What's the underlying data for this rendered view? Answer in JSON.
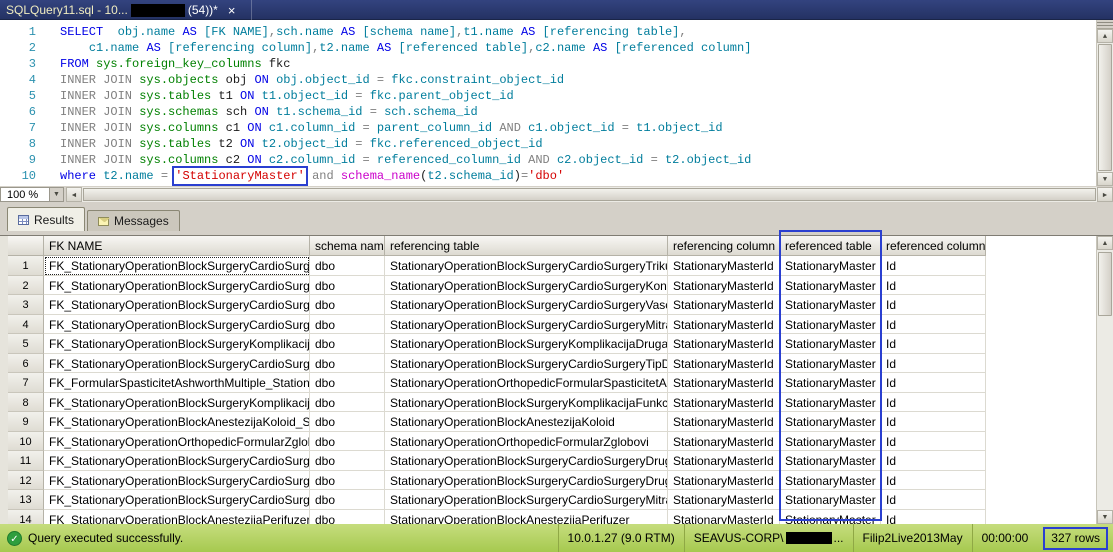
{
  "colors": {
    "annotation_blue": "#2A3FD0",
    "status_bar_green": "#B3D465",
    "keyword_blue": "#0000E6",
    "operator_gray": "#808080",
    "identifier_teal": "#007D9C",
    "system_table_green": "#008000",
    "string_red": "#D40000",
    "function_magenta": "#CA00CA",
    "tab_strip_navy": "#2A3A75"
  },
  "title_tab": {
    "label": "SQLQuery11.sql - 10...",
    "suffix": "(54))*",
    "close": "×"
  },
  "editor": {
    "zoom": "100 %",
    "lines": [
      {
        "n": 1,
        "tokens": [
          [
            "kw",
            "SELECT"
          ],
          [
            "pl",
            "  "
          ],
          [
            "id",
            "obj.name"
          ],
          [
            "pl",
            " "
          ],
          [
            "kw",
            "AS"
          ],
          [
            "pl",
            " "
          ],
          [
            "id",
            "[FK NAME]"
          ],
          [
            "op",
            ","
          ],
          [
            "id",
            "sch.name"
          ],
          [
            "pl",
            " "
          ],
          [
            "kw",
            "AS"
          ],
          [
            "pl",
            " "
          ],
          [
            "id",
            "[schema name]"
          ],
          [
            "op",
            ","
          ],
          [
            "id",
            "t1.name"
          ],
          [
            "pl",
            " "
          ],
          [
            "kw",
            "AS"
          ],
          [
            "pl",
            " "
          ],
          [
            "id",
            "[referencing table]"
          ],
          [
            "op",
            ","
          ]
        ]
      },
      {
        "n": 2,
        "tokens": [
          [
            "pl",
            "    "
          ],
          [
            "id",
            "c1.name"
          ],
          [
            "pl",
            " "
          ],
          [
            "kw",
            "AS"
          ],
          [
            "pl",
            " "
          ],
          [
            "id",
            "[referencing column]"
          ],
          [
            "op",
            ","
          ],
          [
            "id",
            "t2.name"
          ],
          [
            "pl",
            " "
          ],
          [
            "kw",
            "AS"
          ],
          [
            "pl",
            " "
          ],
          [
            "id",
            "[referenced table]"
          ],
          [
            "op",
            ","
          ],
          [
            "id",
            "c2.name"
          ],
          [
            "pl",
            " "
          ],
          [
            "kw",
            "AS"
          ],
          [
            "pl",
            " "
          ],
          [
            "id",
            "[referenced column]"
          ]
        ]
      },
      {
        "n": 3,
        "tokens": [
          [
            "kw",
            "FROM"
          ],
          [
            "pl",
            " "
          ],
          [
            "sys",
            "sys.foreign_key_columns"
          ],
          [
            "pl",
            " fkc"
          ]
        ]
      },
      {
        "n": 4,
        "tokens": [
          [
            "op",
            "INNER JOIN"
          ],
          [
            "pl",
            " "
          ],
          [
            "sys",
            "sys.objects"
          ],
          [
            "pl",
            " obj "
          ],
          [
            "kw",
            "ON"
          ],
          [
            "pl",
            " "
          ],
          [
            "id",
            "obj.object_id"
          ],
          [
            "pl",
            " "
          ],
          [
            "op",
            "="
          ],
          [
            "pl",
            " "
          ],
          [
            "id",
            "fkc.constraint_object_id"
          ]
        ]
      },
      {
        "n": 5,
        "tokens": [
          [
            "op",
            "INNER JOIN"
          ],
          [
            "pl",
            " "
          ],
          [
            "sys",
            "sys.tables"
          ],
          [
            "pl",
            " t1 "
          ],
          [
            "kw",
            "ON"
          ],
          [
            "pl",
            " "
          ],
          [
            "id",
            "t1.object_id"
          ],
          [
            "pl",
            " "
          ],
          [
            "op",
            "="
          ],
          [
            "pl",
            " "
          ],
          [
            "id",
            "fkc.parent_object_id"
          ]
        ]
      },
      {
        "n": 6,
        "tokens": [
          [
            "op",
            "INNER JOIN"
          ],
          [
            "pl",
            " "
          ],
          [
            "sys",
            "sys.schemas"
          ],
          [
            "pl",
            " sch "
          ],
          [
            "kw",
            "ON"
          ],
          [
            "pl",
            " "
          ],
          [
            "id",
            "t1.schema_id"
          ],
          [
            "pl",
            " "
          ],
          [
            "op",
            "="
          ],
          [
            "pl",
            " "
          ],
          [
            "id",
            "sch.schema_id"
          ]
        ]
      },
      {
        "n": 7,
        "tokens": [
          [
            "op",
            "INNER JOIN"
          ],
          [
            "pl",
            " "
          ],
          [
            "sys",
            "sys.columns"
          ],
          [
            "pl",
            " c1 "
          ],
          [
            "kw",
            "ON"
          ],
          [
            "pl",
            " "
          ],
          [
            "id",
            "c1.column_id"
          ],
          [
            "pl",
            " "
          ],
          [
            "op",
            "="
          ],
          [
            "pl",
            " "
          ],
          [
            "id",
            "parent_column_id"
          ],
          [
            "pl",
            " "
          ],
          [
            "op",
            "AND"
          ],
          [
            "pl",
            " "
          ],
          [
            "id",
            "c1.object_id"
          ],
          [
            "pl",
            " "
          ],
          [
            "op",
            "="
          ],
          [
            "pl",
            " "
          ],
          [
            "id",
            "t1.object_id"
          ]
        ]
      },
      {
        "n": 8,
        "tokens": [
          [
            "op",
            "INNER JOIN"
          ],
          [
            "pl",
            " "
          ],
          [
            "sys",
            "sys.tables"
          ],
          [
            "pl",
            " t2 "
          ],
          [
            "kw",
            "ON"
          ],
          [
            "pl",
            " "
          ],
          [
            "id",
            "t2.object_id"
          ],
          [
            "pl",
            " "
          ],
          [
            "op",
            "="
          ],
          [
            "pl",
            " "
          ],
          [
            "id",
            "fkc.referenced_object_id"
          ]
        ]
      },
      {
        "n": 9,
        "tokens": [
          [
            "op",
            "INNER JOIN"
          ],
          [
            "pl",
            " "
          ],
          [
            "sys",
            "sys.columns"
          ],
          [
            "pl",
            " c2 "
          ],
          [
            "kw",
            "ON"
          ],
          [
            "pl",
            " "
          ],
          [
            "id",
            "c2.column_id"
          ],
          [
            "pl",
            " "
          ],
          [
            "op",
            "="
          ],
          [
            "pl",
            " "
          ],
          [
            "id",
            "referenced_column_id"
          ],
          [
            "pl",
            " "
          ],
          [
            "op",
            "AND"
          ],
          [
            "pl",
            " "
          ],
          [
            "id",
            "c2.object_id"
          ],
          [
            "pl",
            " "
          ],
          [
            "op",
            "="
          ],
          [
            "pl",
            " "
          ],
          [
            "id",
            "t2.object_id"
          ]
        ]
      },
      {
        "n": 10,
        "tokens": [
          [
            "kw",
            "where"
          ],
          [
            "pl",
            " "
          ],
          [
            "id",
            "t2.name"
          ],
          [
            "pl",
            " "
          ],
          [
            "op",
            "="
          ],
          [
            "pl",
            " "
          ],
          [
            "strbox",
            "'StationaryMaster'"
          ],
          [
            "pl",
            " "
          ],
          [
            "op",
            "and"
          ],
          [
            "pl",
            " "
          ],
          [
            "fn",
            "schema_name"
          ],
          [
            "pl",
            "("
          ],
          [
            "id",
            "t2.schema_id"
          ],
          [
            "pl",
            ")"
          ],
          [
            "op",
            "="
          ],
          [
            "str",
            "'dbo'"
          ]
        ]
      }
    ]
  },
  "results_pane": {
    "tabs": [
      {
        "label": "Results"
      },
      {
        "label": "Messages"
      }
    ]
  },
  "grid": {
    "columns": [
      "",
      "FK NAME",
      "schema name",
      "referencing table",
      "referencing column",
      "referenced table",
      "referenced column"
    ],
    "highlighted_column": "referenced table",
    "rows": [
      [
        "1",
        "FK_StationaryOperationBlockSurgeryCardioSurgeryTri...",
        "dbo",
        "StationaryOperationBlockSurgeryCardioSurgeryTrikus...",
        "StationaryMasterId",
        "StationaryMaster",
        "Id"
      ],
      [
        "2",
        "FK_StationaryOperationBlockSurgeryCardioSurgeryK...",
        "dbo",
        "StationaryOperationBlockSurgeryCardioSurgeryKong...",
        "StationaryMasterId",
        "StationaryMaster",
        "Id"
      ],
      [
        "3",
        "FK_StationaryOperationBlockSurgeryCardioSurgeryV...",
        "dbo",
        "StationaryOperationBlockSurgeryCardioSurgeryVasc...",
        "StationaryMasterId",
        "StationaryMaster",
        "Id"
      ],
      [
        "4",
        "FK_StationaryOperationBlockSurgeryCardioSurgeryMi...",
        "dbo",
        "StationaryOperationBlockSurgeryCardioSurgeryMitral...",
        "StationaryMasterId",
        "StationaryMaster",
        "Id"
      ],
      [
        "5",
        "FK_StationaryOperationBlockSurgeryKomplikacijaDru...",
        "dbo",
        "StationaryOperationBlockSurgeryKomplikacijaDrugaK...",
        "StationaryMasterId",
        "StationaryMaster",
        "Id"
      ],
      [
        "6",
        "FK_StationaryOperationBlockSurgeryCardioSurgeryTi...",
        "dbo",
        "StationaryOperationBlockSurgeryCardioSurgeryTipDi...",
        "StationaryMasterId",
        "StationaryMaster",
        "Id"
      ],
      [
        "7",
        "FK_FormularSpasticitetAshworthMultiple_StationaryM...",
        "dbo",
        "StationaryOperationOrthopedicFormularSpasticitetAs...",
        "StationaryMasterId",
        "StationaryMaster",
        "Id"
      ],
      [
        "8",
        "FK_StationaryOperationBlockSurgeryKomplikacijaFun...",
        "dbo",
        "StationaryOperationBlockSurgeryKomplikacijaFunkcij...",
        "StationaryMasterId",
        "StationaryMaster",
        "Id"
      ],
      [
        "9",
        "FK_StationaryOperationBlockAnestezijaKoloid_Statio...",
        "dbo",
        "StationaryOperationBlockAnestezijaKoloid",
        "StationaryMasterId",
        "StationaryMaster",
        "Id"
      ],
      [
        "10",
        "FK_StationaryOperationOrthopedicFormularZglobovi_...",
        "dbo",
        "StationaryOperationOrthopedicFormularZglobovi",
        "StationaryMasterId",
        "StationaryMaster",
        "Id"
      ],
      [
        "11",
        "FK_StationaryOperationBlockSurgeryCardioSurgeryDr...",
        "dbo",
        "StationaryOperationBlockSurgeryCardioSurgeryDrugi...",
        "StationaryMasterId",
        "StationaryMaster",
        "Id"
      ],
      [
        "12",
        "FK_StationaryOperationBlockSurgeryCardioSurgeryDr...",
        "dbo",
        "StationaryOperationBlockSurgeryCardioSurgeryDrugi...",
        "StationaryMasterId",
        "StationaryMaster",
        "Id"
      ],
      [
        "13",
        "FK_StationaryOperationBlockSurgeryCardioSurgeryMi...",
        "dbo",
        "StationaryOperationBlockSurgeryCardioSurgeryMitral...",
        "StationaryMasterId",
        "StationaryMaster",
        "Id"
      ],
      [
        "14",
        "FK_StationaryOperationBlockAnestezijaPerifuzer_Stat...",
        "dbo",
        "StationaryOperationBlockAnestezijaPerifuzer",
        "StationaryMasterId",
        "StationaryMaster",
        "Id"
      ]
    ]
  },
  "status_bar": {
    "message": "Query executed successfully.",
    "check": "✓",
    "items": [
      {
        "name": "server-version",
        "text": "10.0.1.27 (9.0 RTM)"
      },
      {
        "name": "login",
        "text": "SEAVUS-CORP\\",
        "redacted": true,
        "post": "..."
      },
      {
        "name": "database",
        "text": "Filip2Live2013May"
      },
      {
        "name": "elapsed-time",
        "text": "00:00:00"
      },
      {
        "name": "row-count",
        "text": "327 rows",
        "boxed": true
      }
    ]
  }
}
